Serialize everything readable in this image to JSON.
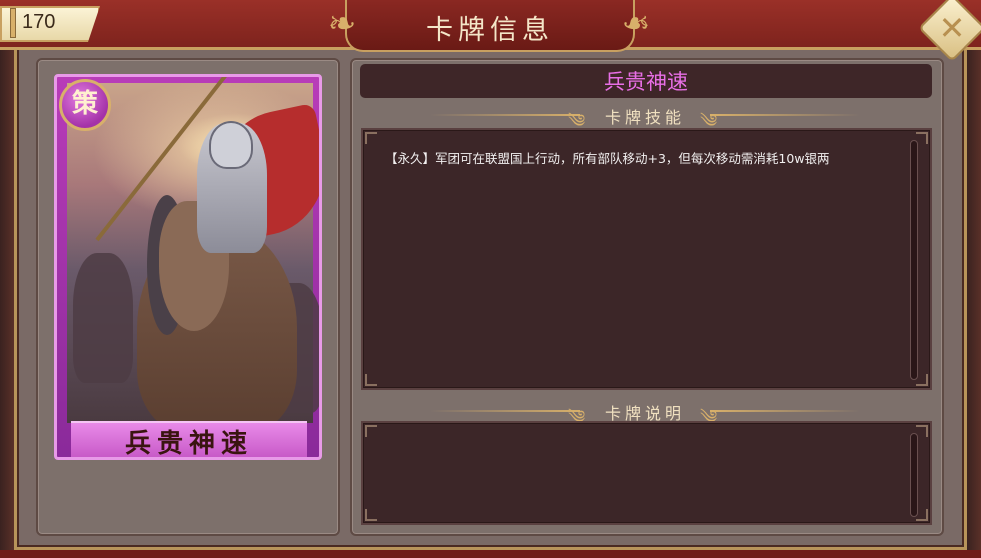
{
  "counter": {
    "value": "170"
  },
  "window": {
    "title": "卡牌信息"
  },
  "card": {
    "badge_char": "策",
    "name": "兵贵神速",
    "frame_color": "#c85ac8"
  },
  "detail": {
    "card_name": "兵贵神速",
    "card_name_color": "#e86fe6",
    "skill_section_label": "卡牌技能",
    "skill_text": "【永久】军团可在联盟国上行动，所有部队移动+3，但每次移动需消耗10w银两",
    "desc_section_label": "卡牌说明",
    "desc_text": ""
  },
  "icons": {
    "close": "close-icon",
    "badge": "strategy-badge-icon"
  }
}
